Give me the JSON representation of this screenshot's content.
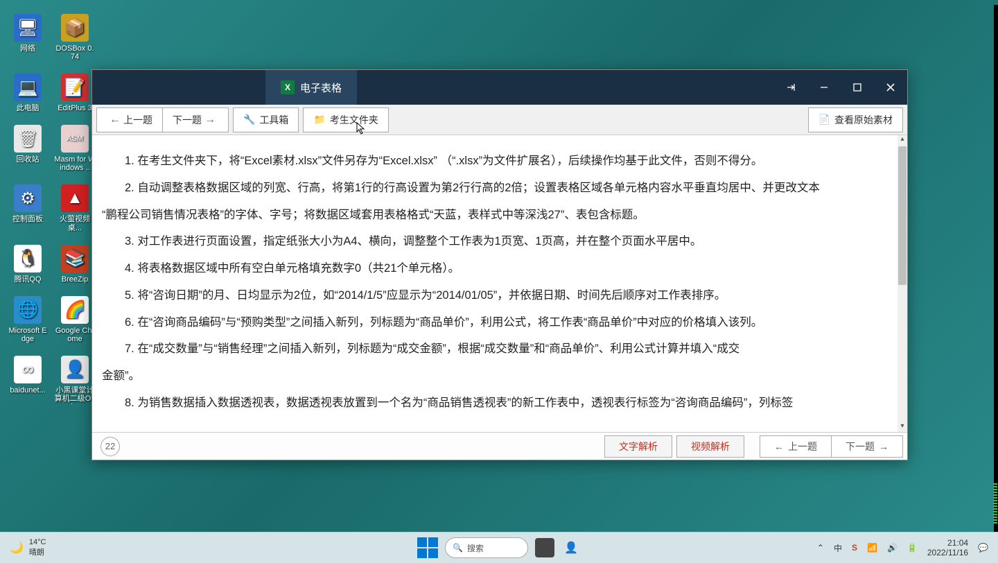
{
  "desktop_icons": [
    {
      "label": "网络",
      "bg": "#2a6dc9",
      "glyph": "🖥"
    },
    {
      "label": "DOSBox 0.74",
      "bg": "#c9a020",
      "glyph": "📦"
    },
    {
      "label": "此电脑",
      "bg": "#2a6dc9",
      "glyph": "💻"
    },
    {
      "label": "EditPlus 3",
      "bg": "#d03030",
      "glyph": "📝"
    },
    {
      "label": "回收站",
      "bg": "#e8e8e8",
      "glyph": "🗑"
    },
    {
      "label": "Masm for Windows ..",
      "bg": "#e8d0d0",
      "glyph": "ASM"
    },
    {
      "label": "控制面板",
      "bg": "#3a7dc9",
      "glyph": "⚙"
    },
    {
      "label": "火萤视频桌...",
      "bg": "#d02020",
      "glyph": "▲"
    },
    {
      "label": "腾讯QQ",
      "bg": "#ffffff",
      "glyph": "🐧"
    },
    {
      "label": "BreeZip",
      "bg": "#c04020",
      "glyph": "📚"
    },
    {
      "label": "Microsoft Edge",
      "bg": "#2a8dc9",
      "glyph": "🌐"
    },
    {
      "label": "Google Chrome",
      "bg": "#ffffff",
      "glyph": "🌈"
    },
    {
      "label": "baidunet...",
      "bg": "#ffffff",
      "glyph": "∞"
    },
    {
      "label": "小黑课堂计算机二级Offi...",
      "bg": "#e8e8e8",
      "glyph": "👤"
    }
  ],
  "app": {
    "tab_label": "电子表格",
    "toolbar": {
      "prev": "上一题",
      "next": "下一题",
      "toolbox": "工具箱",
      "folder": "考生文件夹",
      "view_original": "查看原始素材"
    },
    "instructions": [
      "1. 在考生文件夹下，将“Excel素材.xlsx”文件另存为“Excel.xlsx” （“.xlsx”为文件扩展名），后续操作均基于此文件，否则不得分。",
      "2. 自动调整表格数据区域的列宽、行高，将第1行的行高设置为第2行行高的2倍；设置表格区域各单元格内容水平垂直均居中、并更改文本“鹏程公司销售情况表格”的字体、字号；将数据区域套用表格格式“天蓝，表样式中等深浅27”、表包含标题。",
      "3. 对工作表进行页面设置，指定纸张大小为A4、横向，调整整个工作表为1页宽、1页高，并在整个页面水平居中。",
      "4. 将表格数据区域中所有空白单元格填充数字0（共21个单元格）。",
      "5. 将“咨询日期”的月、日均显示为2位，如“2014/1/5”应显示为“2014/01/05”，并依据日期、时间先后顺序对工作表排序。",
      "6. 在“咨询商品编码”与“预购类型”之间插入新列，列标题为“商品单价”，利用公式，将工作表“商品单价”中对应的价格填入该列。",
      "7. 在“成交数量”与“销售经理”之间插入新列，列标题为“成交金额”，根据“成交数量”和“商品单价”、利用公式计算并填入“成交金额”。",
      "8. 为销售数据插入数据透视表，数据透视表放置到一个名为“商品销售透视表”的新工作表中，透视表行标签为“咨询商品编码”，列标签"
    ],
    "question_number": "22",
    "footer": {
      "text_analysis": "文字解析",
      "video_analysis": "视频解析",
      "prev": "上一题",
      "next": "下一题"
    }
  },
  "taskbar": {
    "weather_temp": "14°C",
    "weather_cond": "晴朗",
    "search_placeholder": "搜索",
    "time": "21:04",
    "date": "2022/11/16"
  }
}
